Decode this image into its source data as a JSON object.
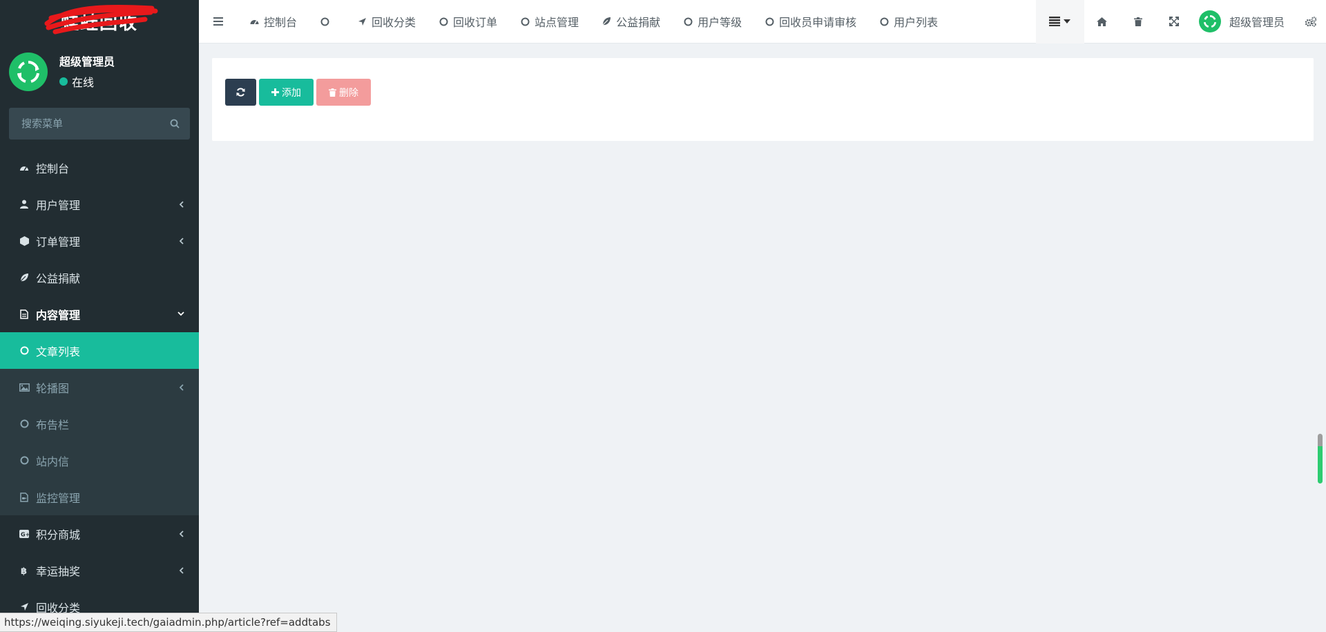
{
  "sidebar": {
    "logo": "蛙蛙回收",
    "user": {
      "name": "超级管理员",
      "status": "在线"
    },
    "search": {
      "placeholder": "搜索菜单"
    },
    "items": [
      {
        "label": "控制台",
        "icon": "dashboard-icon"
      },
      {
        "label": "用户管理",
        "icon": "user-icon",
        "arrow": "chevron-left"
      },
      {
        "label": "订单管理",
        "icon": "cube-icon",
        "arrow": "chevron-left"
      },
      {
        "label": "公益捐献",
        "icon": "leaf-icon"
      },
      {
        "label": "内容管理",
        "icon": "file-icon",
        "arrow": "chevron-down"
      }
    ],
    "submenu": [
      {
        "label": "文章列表",
        "icon": "circle-o-icon",
        "active": true
      },
      {
        "label": "轮播图",
        "icon": "image-icon",
        "arrow": "chevron-left"
      },
      {
        "label": "布告栏",
        "icon": "circle-o-icon"
      },
      {
        "label": "站内信",
        "icon": "circle-o-icon"
      },
      {
        "label": "监控管理",
        "icon": "file-video-icon"
      }
    ],
    "bottom_items": [
      {
        "label": "积分商城",
        "icon": "google-plus-icon",
        "arrow": "chevron-left"
      },
      {
        "label": "幸运抽奖",
        "icon": "bitcoin-icon",
        "arrow": "chevron-left"
      },
      {
        "label": "回收分类",
        "icon": "location-arrow-icon"
      }
    ]
  },
  "navbar": {
    "tabs": [
      {
        "label": "控制台",
        "icon": "dashboard-icon"
      },
      {
        "label": "",
        "icon": "circle-o-icon"
      },
      {
        "label": "回收分类",
        "icon": "location-arrow-icon"
      },
      {
        "label": "回收订单",
        "icon": "circle-o-icon"
      },
      {
        "label": "站点管理",
        "icon": "circle-o-icon"
      },
      {
        "label": "公益捐献",
        "icon": "leaf-icon"
      },
      {
        "label": "用户等级",
        "icon": "circle-o-icon"
      },
      {
        "label": "回收员申请审核",
        "icon": "circle-o-icon"
      },
      {
        "label": "用户列表",
        "icon": "circle-o-icon"
      }
    ],
    "user_name": "超级管理员"
  },
  "toolbar": {
    "add_label": "添加",
    "delete_label": "删除"
  },
  "status_url": "https://weiqing.siyukeji.tech/gaiadmin.php/article?ref=addtabs",
  "colors": {
    "sidebar_bg": "#222d32",
    "active_green": "#18bc9c",
    "avatar_green": "#1fbf68",
    "dark_button": "#2c3e50",
    "danger_light": "#f39c9c"
  }
}
